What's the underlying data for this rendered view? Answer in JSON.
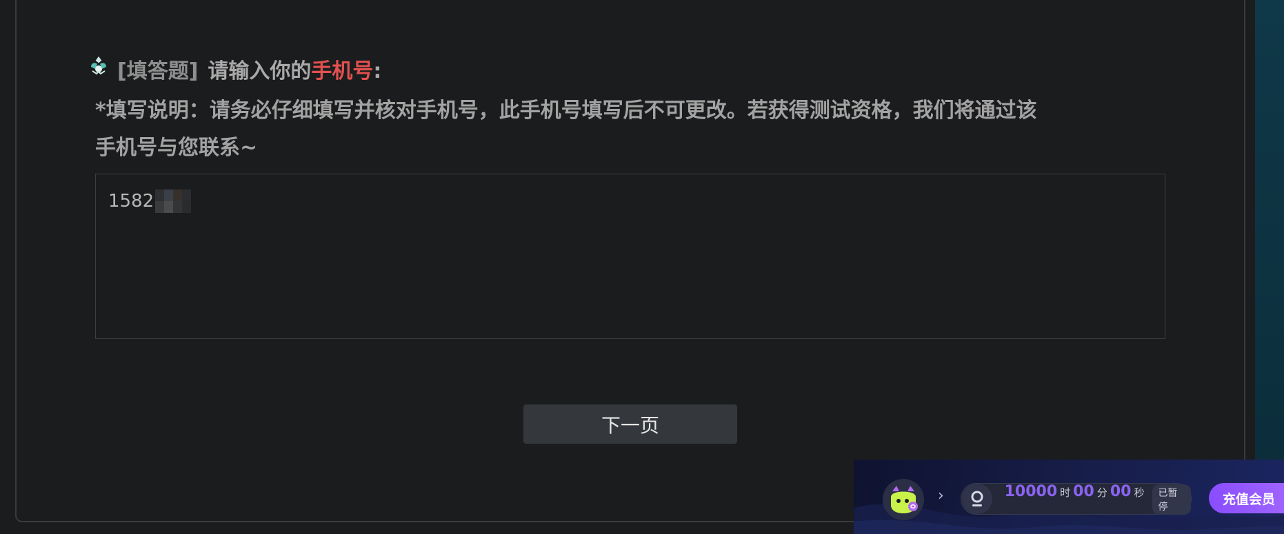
{
  "question": {
    "type_label": "[填答题]",
    "prompt_prefix": "请输入你的",
    "prompt_highlight": "手机号",
    "prompt_suffix": ":",
    "description_line1": "*填写说明：请务必仔细填写并核对手机号，此手机号填写后不可更改。若获得测试资格，我们将通过该",
    "description_line2": "手机号与您联系~",
    "answer_value": "1582",
    "highlight_color": "#e0514f"
  },
  "navigation": {
    "next_label": "下一页"
  },
  "status_bar": {
    "timer_hours": "10000",
    "hours_unit": "时",
    "timer_minutes": "00",
    "minutes_unit": "分",
    "timer_seconds": "00",
    "seconds_unit": "秒",
    "paused_label": "已暂停",
    "recharge_label": "充值会员",
    "accent_color": "#8a63f2"
  }
}
